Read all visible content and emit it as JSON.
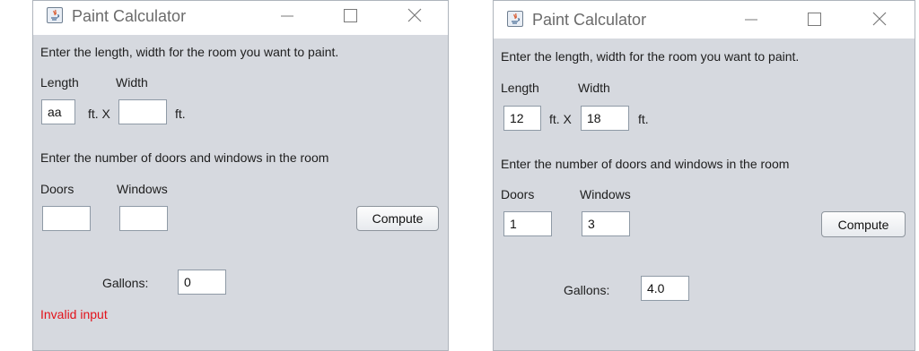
{
  "windows": [
    {
      "title": "Paint Calculator",
      "instructions_dims": "Enter the length, width for the room you want to paint.",
      "length_label": "Length",
      "width_label": "Width",
      "length_value": "aa",
      "width_value": "",
      "ft_x": "ft. X",
      "ft": "ft.",
      "instructions_openings": "Enter the number of doors and windows in the room",
      "doors_label": "Doors",
      "windows_label": "Windows",
      "doors_value": "",
      "windows_value": "",
      "compute_label": "Compute",
      "gallons_label": "Gallons:",
      "gallons_value": "0",
      "status_text": "Invalid input"
    },
    {
      "title": "Paint Calculator",
      "instructions_dims": "Enter the length, width for the room you want to paint.",
      "length_label": "Length",
      "width_label": "Width",
      "length_value": "12",
      "width_value": "18",
      "ft_x": "ft. X",
      "ft": "ft.",
      "instructions_openings": "Enter the number of doors and windows in the room",
      "doors_label": "Doors",
      "windows_label": "Windows",
      "doors_value": "1",
      "windows_value": "3",
      "compute_label": "Compute",
      "gallons_label": "Gallons:",
      "gallons_value": "4.0",
      "status_text": ""
    }
  ],
  "colors": {
    "panel": "#d6d9df",
    "titlebar": "#ffffff",
    "error": "#e3121a"
  },
  "icons": [
    "java-app-icon",
    "minimize-icon",
    "maximize-icon",
    "close-icon"
  ]
}
